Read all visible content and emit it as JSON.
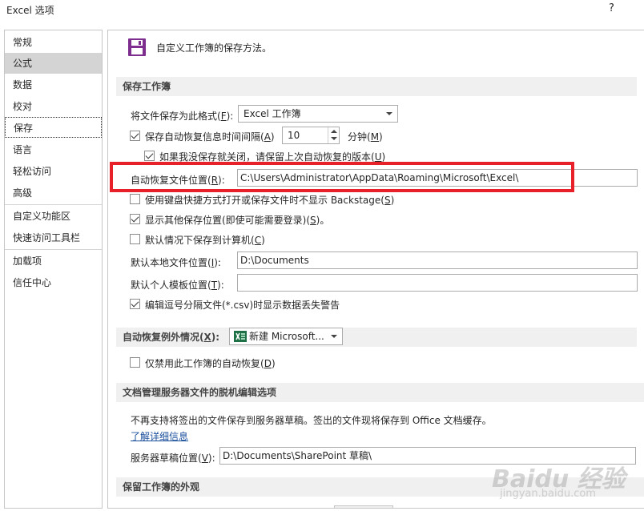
{
  "window": {
    "title": "Excel 选项",
    "help": "?"
  },
  "sidebar": {
    "items": [
      {
        "label": "常规"
      },
      {
        "label": "公式"
      },
      {
        "label": "数据"
      },
      {
        "label": "校对"
      },
      {
        "label": "保存"
      },
      {
        "label": "语言"
      },
      {
        "label": "轻松访问"
      },
      {
        "label": "高级"
      },
      {
        "label": "自定义功能区"
      },
      {
        "label": "快速访问工具栏"
      },
      {
        "label": "加载项"
      },
      {
        "label": "信任中心"
      }
    ]
  },
  "header": {
    "intro": "自定义工作簿的保存方法。"
  },
  "save_workbooks": {
    "heading": "保存工作簿",
    "format_label": "将文件保存为此格式(",
    "format_key": "F",
    "format_suffix": "):",
    "format_value": "Excel 工作簿",
    "autorecover_label": "保存自动恢复信息时间间隔(",
    "autorecover_key": "A",
    "autorecover_suffix": ")",
    "autorecover_minutes": "10",
    "minutes_label": "分钟(",
    "minutes_key": "M",
    "minutes_suffix": ")",
    "keep_last_label": "如果我没保存就关闭，请保留上次自动恢复的版本(",
    "keep_last_key": "U",
    "keep_last_suffix": ")",
    "autorecover_location_label": "自动恢复文件位置(",
    "autorecover_location_key": "R",
    "autorecover_location_suffix": "):",
    "autorecover_location_value": "C:\\Users\\Administrator\\AppData\\Roaming\\Microsoft\\Excel\\",
    "backstage_label": "使用键盘快捷方式打开或保存文件时不显示 Backstage(",
    "backstage_key": "S",
    "backstage_suffix": ")",
    "show_other_label": "显示其他保存位置(即使可能需要登录)(",
    "show_other_key": "S",
    "show_other_suffix": ")。",
    "save_to_computer_label": "默认情况下保存到计算机(",
    "save_to_computer_key": "C",
    "save_to_computer_suffix": ")",
    "local_location_label": "默认本地文件位置(",
    "local_location_key": "I",
    "local_location_suffix": "):",
    "local_location_value": "D:\\Documents",
    "template_location_label": "默认个人模板位置(",
    "template_location_key": "T",
    "template_location_suffix": "):",
    "template_location_value": "",
    "csv_warning_label": "编辑逗号分隔文件(*.csv)时显示数据丢失警告"
  },
  "autorecover_exceptions": {
    "label": "自动恢复例外情况(",
    "key": "X",
    "suffix": "):",
    "workbook_value": "新建 Microsoft...",
    "disable_label": "仅禁用此工作簿的自动恢复(",
    "disable_key": "D",
    "disable_suffix": ")"
  },
  "offline_editing": {
    "heading": "文档管理服务器文件的脱机编辑选项",
    "note": "不再支持将签出的文件保存到服务器草稿。签出的文件现将保存到 Office 文档缓存。",
    "learn_more": "了解详细信息",
    "drafts_label": "服务器草稿位置(",
    "drafts_key": "V",
    "drafts_suffix": "):",
    "drafts_value": "D:\\Documents\\SharePoint 草稿\\"
  },
  "appearance": {
    "heading": "保留工作簿的外观"
  },
  "watermark": {
    "brand": "Baidu 经验",
    "url": "jingyan.baidu.com"
  },
  "colors": {
    "highlight_box": "#e8202a",
    "save_icon": "#7d2e8e",
    "excel_green": "#1e7145",
    "link": "#1a4f9c"
  }
}
